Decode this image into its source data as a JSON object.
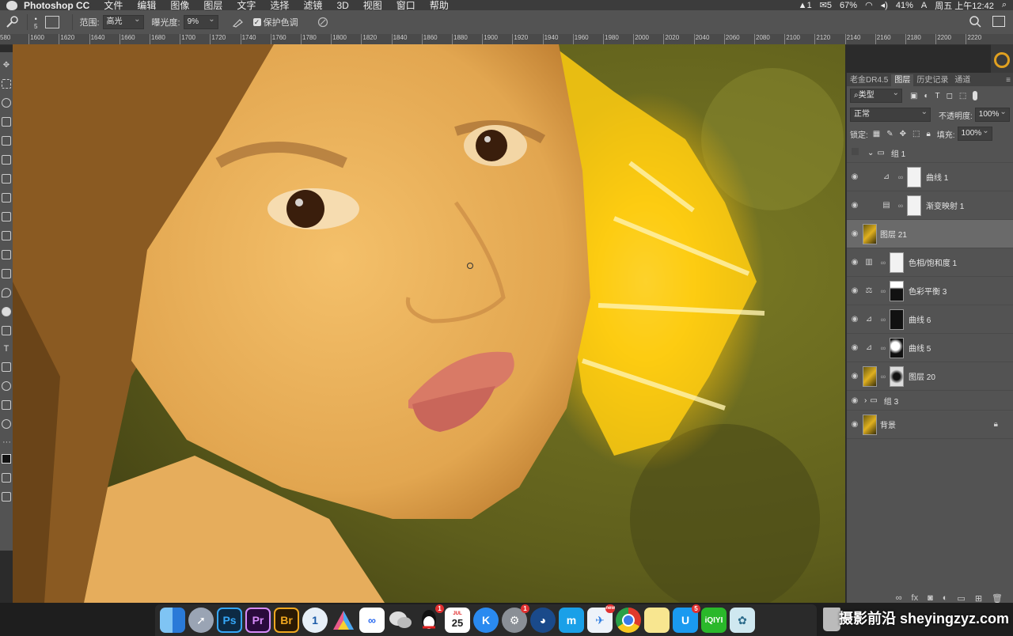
{
  "menubar": {
    "app_name": "Photoshop CC",
    "menus": [
      "文件",
      "编辑",
      "图像",
      "图层",
      "文字",
      "选择",
      "滤镜",
      "3D",
      "视图",
      "窗口",
      "帮助"
    ],
    "status": {
      "notif1": "1",
      "wechat_badge": "5",
      "percent1": "67%",
      "battery": "41%",
      "input": "A",
      "clock": "周五 上午12:42"
    }
  },
  "options": {
    "brush_size": "5",
    "range_label": "范围:",
    "range_value": "高光",
    "exposure_label": "曝光度:",
    "exposure_value": "9%",
    "protect_label": "保护色调"
  },
  "ruler": {
    "ticks": [
      "580",
      "1600",
      "1620",
      "1640",
      "1660",
      "1680",
      "1700",
      "1720",
      "1740",
      "1760",
      "1780",
      "1800",
      "1820",
      "1840",
      "1860",
      "1880",
      "1900",
      "1920",
      "1940",
      "1960",
      "1980",
      "2000",
      "2020",
      "2040",
      "2060",
      "2080",
      "2100",
      "2120",
      "2140",
      "2160",
      "2180",
      "2200",
      "2220"
    ]
  },
  "layers_panel": {
    "tabs": [
      "老金DR4.5",
      "图层",
      "历史记录",
      "通道"
    ],
    "filter_label": "类型",
    "blend_mode": "正常",
    "opacity_label": "不透明度:",
    "opacity_value": "100%",
    "lock_label": "锁定:",
    "fill_label": "填充:",
    "fill_value": "100%",
    "layers": [
      {
        "name": "组 1",
        "kind": "group"
      },
      {
        "name": "曲线 1",
        "kind": "curves"
      },
      {
        "name": "渐变映射 1",
        "kind": "gradient-map"
      },
      {
        "name": "图层 21",
        "kind": "pixel",
        "selected": true
      },
      {
        "name": "色相/饱和度 1",
        "kind": "hue-sat"
      },
      {
        "name": "色彩平衡 3",
        "kind": "color-balance"
      },
      {
        "name": "曲线 6",
        "kind": "curves"
      },
      {
        "name": "曲线 5",
        "kind": "curves"
      },
      {
        "name": "图层 20",
        "kind": "pixel"
      },
      {
        "name": "组 3",
        "kind": "group"
      },
      {
        "name": "背景",
        "kind": "background"
      }
    ]
  },
  "dock": {
    "apps": [
      "finder",
      "launchpad",
      "Ps",
      "Pr",
      "Br",
      "1password",
      "affinity",
      "baidu-netdisk",
      "wechat",
      "qq",
      "calendar",
      "keynote-k",
      "system-prefs",
      "edge",
      "app-m",
      "mail-new",
      "chrome",
      "notes",
      "u-app",
      "iqiyi",
      "preview"
    ],
    "calendar_day": "25",
    "calendar_month": "JUL",
    "badge_qq": "1",
    "badge_sys": "1",
    "badge_mail": "new",
    "badge_u": "5"
  },
  "watermark": "摄影前沿 sheyingzyz.com"
}
